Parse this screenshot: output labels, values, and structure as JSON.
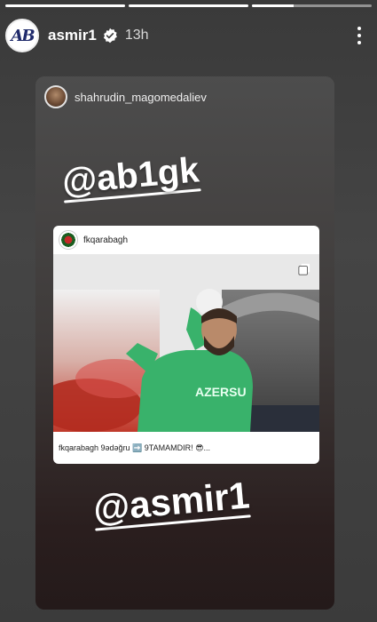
{
  "story": {
    "progress": [
      1,
      1,
      0.35
    ],
    "username": "asmir1",
    "time": "13h",
    "avatar_text": "AB"
  },
  "reshare": {
    "author": "shahrudin_magomedaliev",
    "mention_top": "@ab1gk",
    "mention_bottom": "@asmir1"
  },
  "post": {
    "account": "fkqarabagh",
    "caption": "fkqarabagh 9ədəğru ➡️ 9TAMAMDIR! 😎...",
    "jersey_text": "AZERSU"
  },
  "icons": {
    "verified": "verified-badge-icon",
    "more": "more-options-icon",
    "multi": "carousel-icon"
  }
}
